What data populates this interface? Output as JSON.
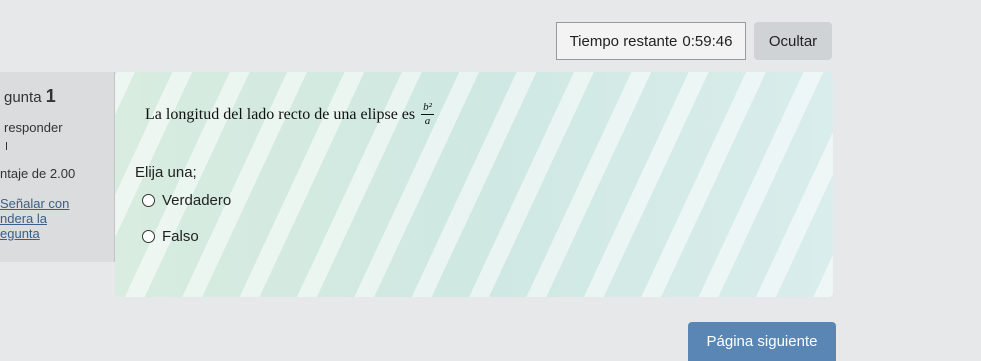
{
  "header": {
    "timer_label": "Tiempo restante",
    "timer_value": "0:59:46",
    "hide_label": "Ocultar"
  },
  "question_info": {
    "number_prefix": "gunta",
    "number": "1",
    "status": "responder",
    "score": "ntaje de 2.00",
    "flag_line1": "Señalar con",
    "flag_line2": "ndera la",
    "flag_line3": "egunta"
  },
  "question": {
    "text": "La longitud  del lado recto de una elipse es",
    "fraction_numerator": "b²",
    "fraction_denominator": "a",
    "prompt": "Elija una;",
    "options": [
      "Verdadero",
      "Falso"
    ]
  },
  "footer": {
    "next_label": "Página siguiente"
  }
}
